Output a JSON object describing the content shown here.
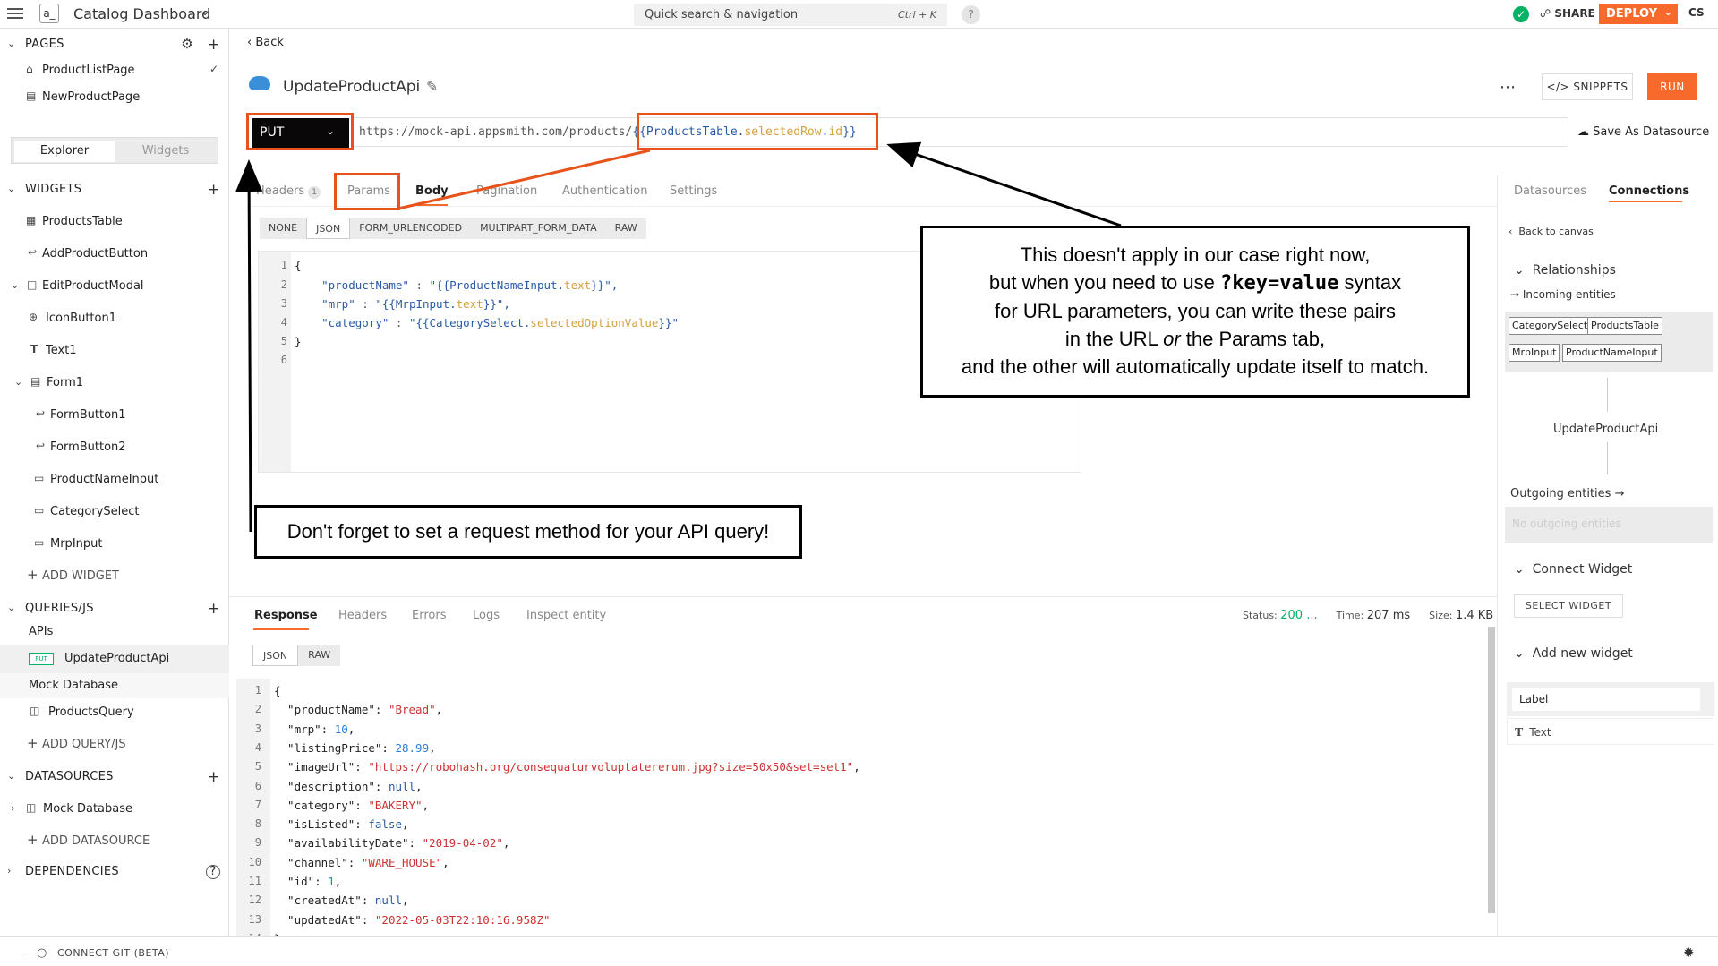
{
  "topbar": {
    "app_logo": "a_",
    "app_title": "Catalog Dashboard",
    "search_placeholder": "Quick search & navigation",
    "search_shortcut": "Ctrl + K",
    "help": "?",
    "share": "SHARE",
    "deploy": "DEPLOY",
    "avatar": "CS"
  },
  "sidebar": {
    "pages_header": "PAGES",
    "pages": [
      "ProductListPage",
      "NewProductPage"
    ],
    "tabs": [
      "Explorer",
      "Widgets"
    ],
    "widgets_header": "WIDGETS",
    "widgets": [
      "ProductsTable",
      "AddProductButton",
      "EditProductModal",
      "IconButton1",
      "Text1",
      "Form1",
      "FormButton1",
      "FormButton2",
      "ProductNameInput",
      "CategorySelect",
      "MrpInput"
    ],
    "add_widget": "ADD WIDGET",
    "queries_header": "QUERIES/JS",
    "apis_group": "APIs",
    "put_badge": "PUT",
    "api_item": "UpdateProductApi",
    "mock_group": "Mock Database",
    "query_item": "ProductsQuery",
    "add_query": "ADD QUERY/JS",
    "datasources_header": "DATASOURCES",
    "datasource_item": "Mock Database",
    "add_datasource": "ADD DATASOURCE",
    "dependencies_header": "DEPENDENCIES"
  },
  "footer": {
    "connect_git": "CONNECT GIT (BETA)"
  },
  "editor": {
    "back": "Back",
    "api_name": "UpdateProductApi",
    "snippets": "SNIPPETS",
    "run": "RUN",
    "method": "PUT",
    "url_static": "https://mock-api.appsmith.com/products/",
    "url_binding_open": "{{ProductsTable.",
    "url_binding_prop": "selectedRow",
    "url_binding_dot": ".",
    "url_binding_id": "id",
    "url_binding_close": "}}",
    "save_as_datasource": "Save As Datasource",
    "tabs": {
      "headers": "Headers",
      "headers_count": "1",
      "params": "Params",
      "body": "Body",
      "pagination": "Pagination",
      "authentication": "Authentication",
      "settings": "Settings"
    },
    "body_types": [
      "NONE",
      "JSON",
      "FORM_URLENCODED",
      "MULTIPART_FORM_DATA",
      "RAW"
    ],
    "body_lines": {
      "n": [
        "1",
        "2",
        "3",
        "4",
        "5",
        "6"
      ],
      "l1": "{",
      "l2_key": "\"productName\"",
      "l2_sep": " : ",
      "l2_a": "\"{{ProductNameInput.",
      "l2_b": "text",
      "l2_c": "}}\",",
      "l3_key": "\"mrp\"",
      "l3_sep": " : ",
      "l3_a": "\"{{MrpInput.",
      "l3_b": "text",
      "l3_c": "}}\",",
      "l4_key": "\"category\"",
      "l4_sep": " : ",
      "l4_a": "\"{{CategorySelect.",
      "l4_b": "selectedOptionValue",
      "l4_c": "}}\"",
      "l5": "}"
    }
  },
  "response": {
    "tabs": [
      "Response",
      "Headers",
      "Errors",
      "Logs",
      "Inspect entity"
    ],
    "status_label": "Status:",
    "status_value": "200 ...",
    "time_label": "Time:",
    "time_value": "207 ms",
    "size_label": "Size:",
    "size_value": "1.4 KB",
    "types": [
      "JSON",
      "RAW"
    ],
    "line_numbers": [
      "1",
      "2",
      "3",
      "4",
      "5",
      "6",
      "7",
      "8",
      "9",
      "10",
      "11",
      "12",
      "13",
      "14"
    ],
    "lines": [
      {
        "k": "{",
        "v": "",
        "t": ""
      },
      {
        "k": "  \"productName\": ",
        "v": "\"Bread\"",
        "t": "s"
      },
      {
        "k": "  \"mrp\": ",
        "v": "10",
        "t": "n"
      },
      {
        "k": "  \"listingPrice\": ",
        "v": "28.99",
        "t": "n"
      },
      {
        "k": "  \"imageUrl\": ",
        "v": "\"https://robohash.org/consequaturvoluptatererum.jpg?size=50x50&set=set1\"",
        "t": "s"
      },
      {
        "k": "  \"description\": ",
        "v": "null",
        "t": "b"
      },
      {
        "k": "  \"category\": ",
        "v": "\"BAKERY\"",
        "t": "s"
      },
      {
        "k": "  \"isListed\": ",
        "v": "false",
        "t": "b"
      },
      {
        "k": "  \"availabilityDate\": ",
        "v": "\"2019-04-02\"",
        "t": "s"
      },
      {
        "k": "  \"channel\": ",
        "v": "\"WARE_HOUSE\"",
        "t": "s"
      },
      {
        "k": "  \"id\": ",
        "v": "1",
        "t": "n"
      },
      {
        "k": "  \"createdAt\": ",
        "v": "null",
        "t": "b"
      },
      {
        "k": "  \"updatedAt\": ",
        "v": "\"2022-05-03T22:10:16.958Z\"",
        "t": "s"
      },
      {
        "k": "}",
        "v": "",
        "t": ""
      }
    ]
  },
  "right_panel": {
    "tab_datasources": "Datasources",
    "tab_connections": "Connections",
    "back_to_canvas": "Back to canvas",
    "relationships": "Relationships",
    "incoming": "Incoming entities",
    "incoming_pills": [
      "CategorySelect",
      "ProductsTable",
      "MrpInput",
      "ProductNameInput"
    ],
    "current_entity": "UpdateProductApi",
    "outgoing": "Outgoing entities",
    "no_outgoing": "No outgoing entities",
    "connect_widget": "Connect Widget",
    "select_widget": "SELECT WIDGET",
    "add_new_widget": "Add new widget",
    "widget_options": [
      "Label",
      "Text"
    ]
  },
  "callouts": {
    "main_l1": "This doesn't apply in our case right now,",
    "main_l2a": "but when you need to use ",
    "main_l2code": "?key=value",
    "main_l2b": " syntax",
    "main_l3": "for URL parameters, you can write these pairs",
    "main_l4a": "in the URL ",
    "main_l4em": "or",
    "main_l4b": " the Params tab,",
    "main_l5": "and the other will automatically update itself to match.",
    "method": "Don't forget to set a request method for your API query!"
  },
  "colors": {
    "accent": "#f86a2b",
    "highlight": "#e8531c",
    "success": "#03b365"
  }
}
